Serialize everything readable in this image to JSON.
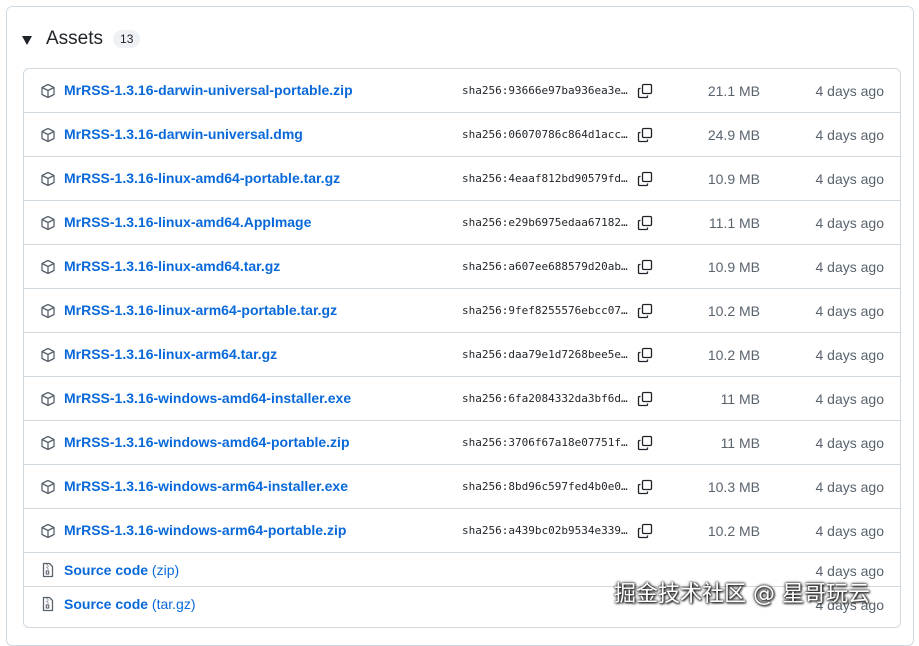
{
  "assets": {
    "title": "Assets",
    "count": "13"
  },
  "files": [
    {
      "name": "MrRSS-1.3.16-darwin-universal-portable.zip",
      "sha": "sha256:93666e97ba936ea3e…",
      "size": "21.1 MB",
      "date": "4 days ago"
    },
    {
      "name": "MrRSS-1.3.16-darwin-universal.dmg",
      "sha": "sha256:06070786c864d1acc…",
      "size": "24.9 MB",
      "date": "4 days ago"
    },
    {
      "name": "MrRSS-1.3.16-linux-amd64-portable.tar.gz",
      "sha": "sha256:4eaaf812bd90579fd…",
      "size": "10.9 MB",
      "date": "4 days ago"
    },
    {
      "name": "MrRSS-1.3.16-linux-amd64.AppImage",
      "sha": "sha256:e29b6975edaa67182…",
      "size": "11.1 MB",
      "date": "4 days ago"
    },
    {
      "name": "MrRSS-1.3.16-linux-amd64.tar.gz",
      "sha": "sha256:a607ee688579d20ab…",
      "size": "10.9 MB",
      "date": "4 days ago"
    },
    {
      "name": "MrRSS-1.3.16-linux-arm64-portable.tar.gz",
      "sha": "sha256:9fef8255576ebcc07…",
      "size": "10.2 MB",
      "date": "4 days ago"
    },
    {
      "name": "MrRSS-1.3.16-linux-arm64.tar.gz",
      "sha": "sha256:daa79e1d7268bee5e…",
      "size": "10.2 MB",
      "date": "4 days ago"
    },
    {
      "name": "MrRSS-1.3.16-windows-amd64-installer.exe",
      "sha": "sha256:6fa2084332da3bf6d…",
      "size": "11 MB",
      "date": "4 days ago"
    },
    {
      "name": "MrRSS-1.3.16-windows-amd64-portable.zip",
      "sha": "sha256:3706f67a18e07751f…",
      "size": "11 MB",
      "date": "4 days ago"
    },
    {
      "name": "MrRSS-1.3.16-windows-arm64-installer.exe",
      "sha": "sha256:8bd96c597fed4b0e0…",
      "size": "10.3 MB",
      "date": "4 days ago"
    },
    {
      "name": "MrRSS-1.3.16-windows-arm64-portable.zip",
      "sha": "sha256:a439bc02b9534e339…",
      "size": "10.2 MB",
      "date": "4 days ago"
    }
  ],
  "source": [
    {
      "label": "Source code",
      "suffix": "(zip)",
      "date": "4 days ago"
    },
    {
      "label": "Source code",
      "suffix": "(tar.gz)",
      "date": "4 days ago"
    }
  ],
  "watermark": "掘金技术社区 @ 星哥玩云",
  "icons": {
    "package": "package-icon",
    "copy": "copy-icon",
    "file-zip": "file-zip-icon",
    "collapse": "triangle-down-icon"
  },
  "colors": {
    "link": "#0969da",
    "muted": "#59636e",
    "border": "#d1d9e0"
  }
}
